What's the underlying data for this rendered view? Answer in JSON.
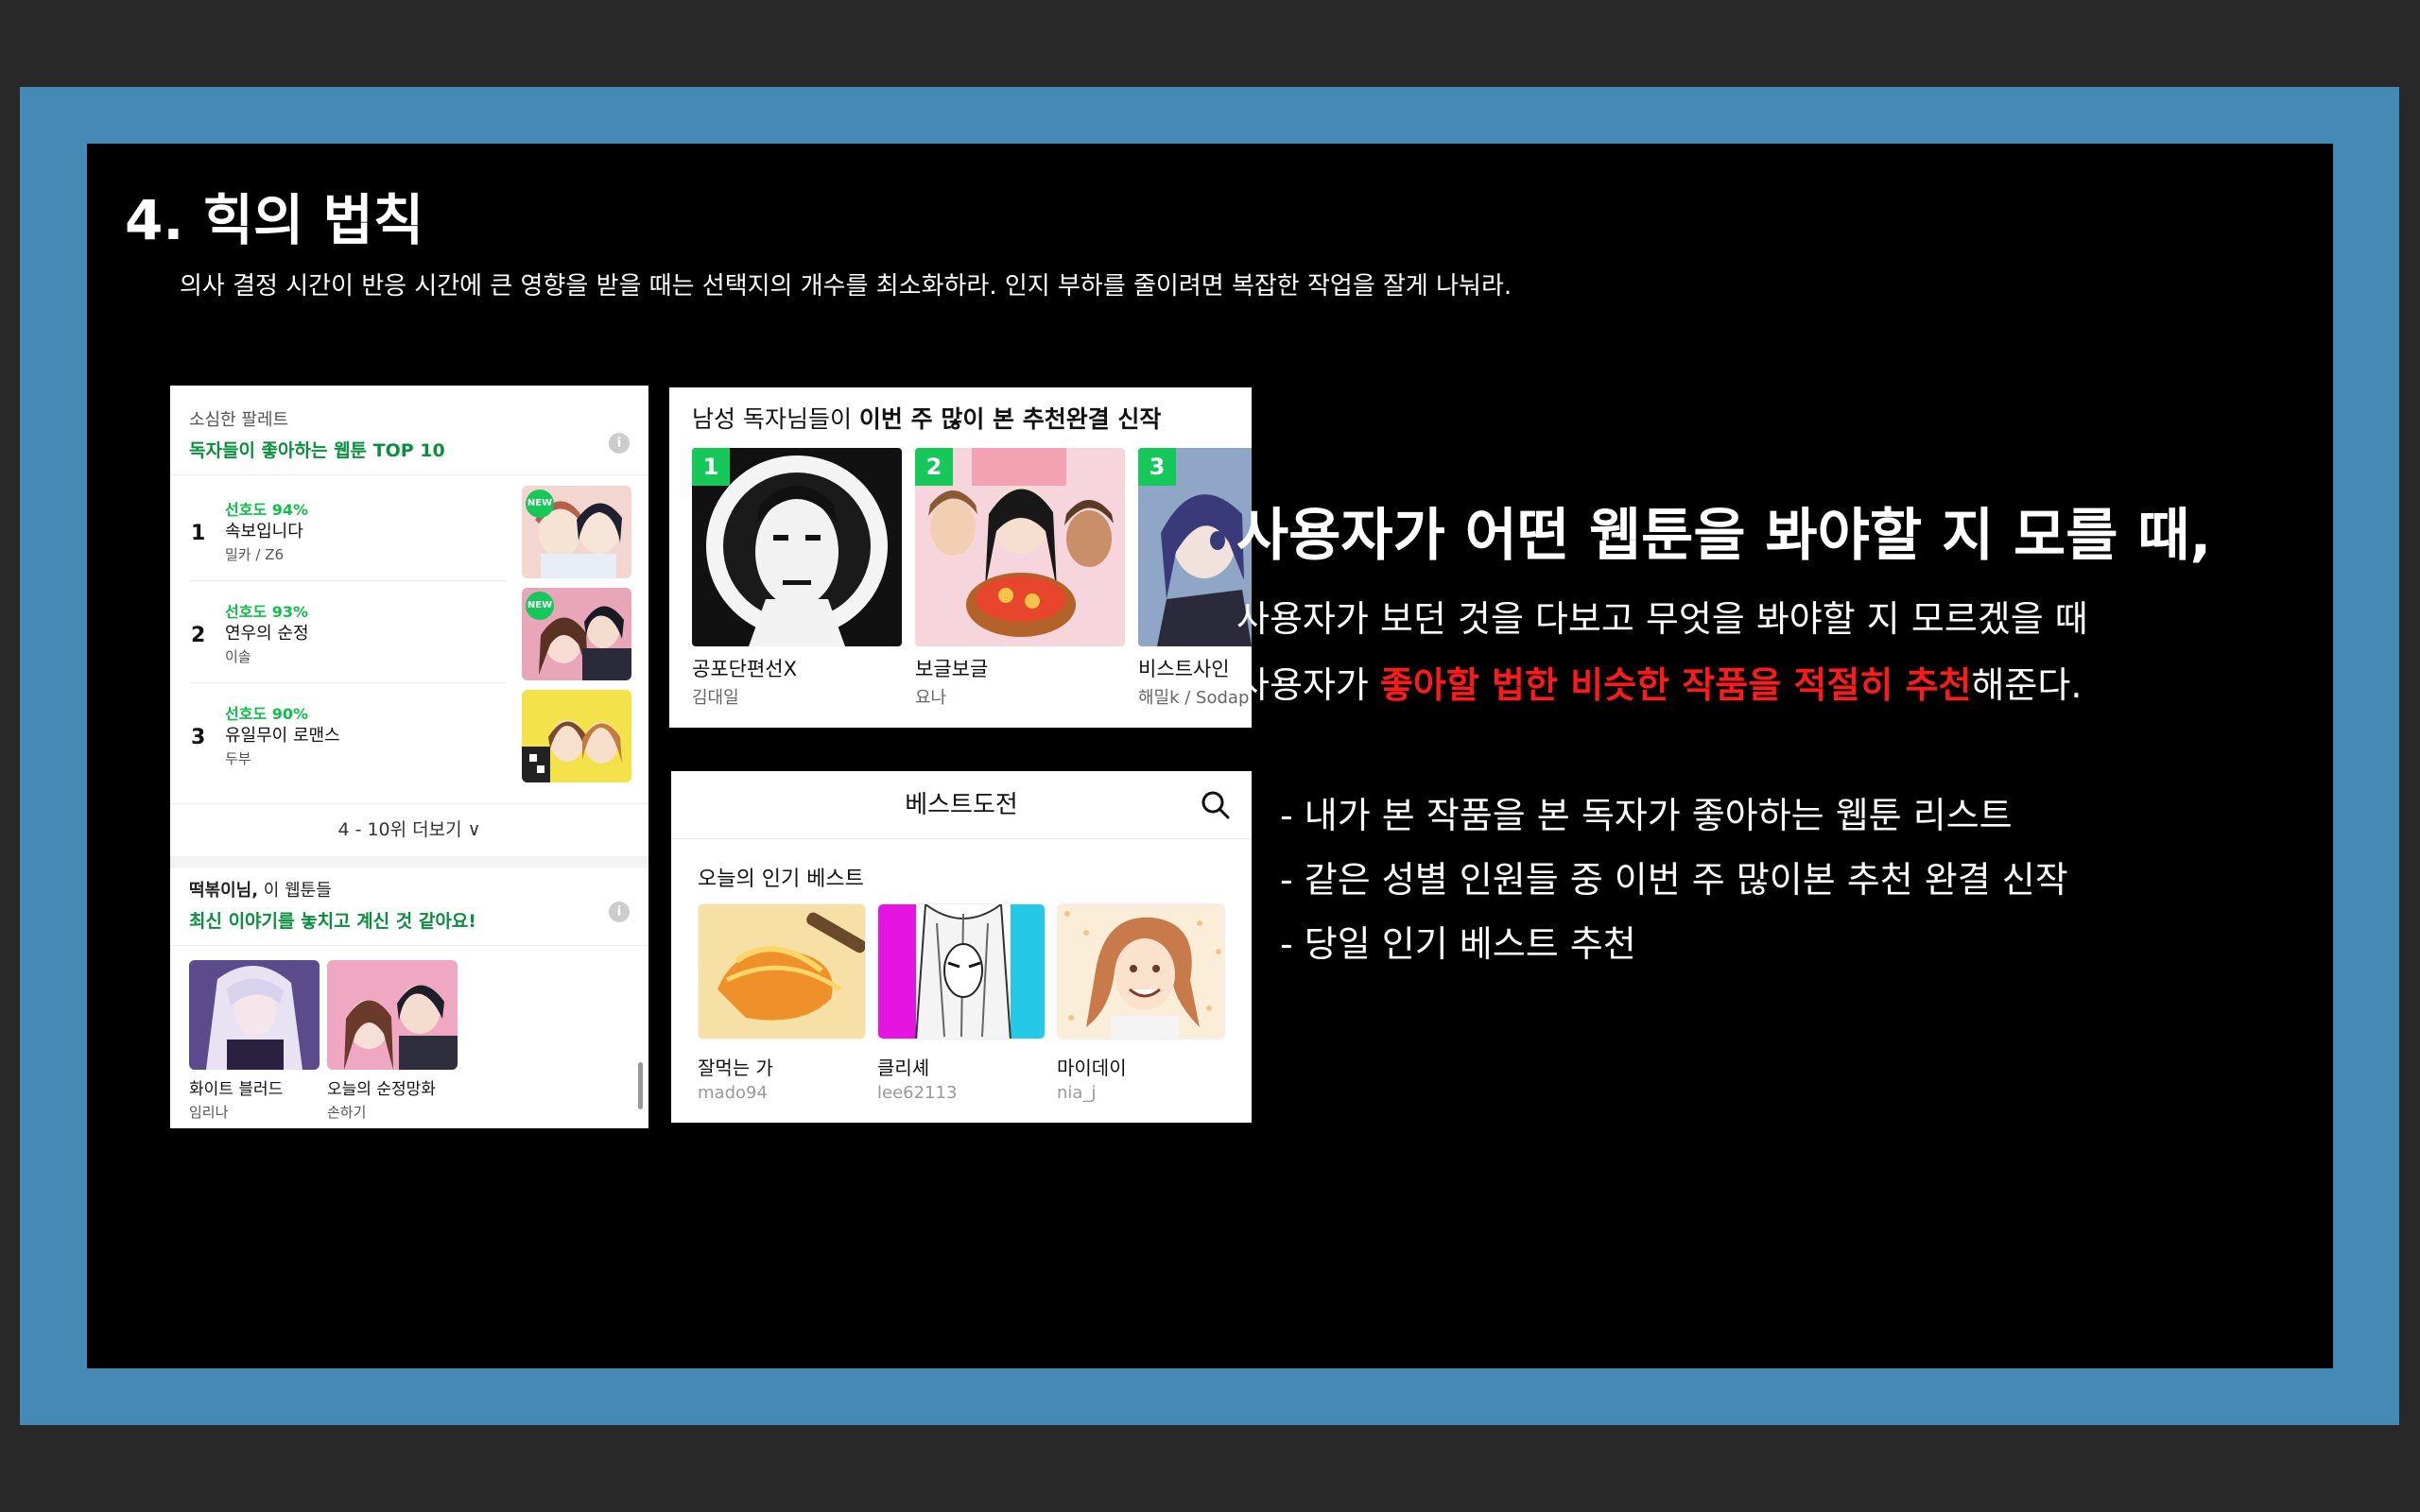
{
  "slide": {
    "title": "4. 힉의 법칙",
    "subtitle": "의사 결정 시간이 반응 시간에 큰 영향을 받을 때는 선택지의 개수를 최소화하라. 인지 부하를 줄이려면 복잡한 작업을 잘게 나눠라."
  },
  "panel1": {
    "label": "소심한 팔레트",
    "heading": "독자들이 좋아하는 웹툰 TOP 10",
    "info": "i",
    "rankings": [
      {
        "rank": "1",
        "preference": "선호도 94%",
        "title": "속보입니다",
        "author": "밀카 / Z6",
        "badge": "NEW"
      },
      {
        "rank": "2",
        "preference": "선호도 93%",
        "title": "연우의 순정",
        "author": "이솔",
        "badge": "NEW"
      },
      {
        "rank": "3",
        "preference": "선호도 90%",
        "title": "유일무이 로맨스",
        "author": "두부",
        "badge": ""
      }
    ],
    "more": "4 - 10위 더보기 ∨",
    "section2_user": "떡볶이님,",
    "section2_rest": " 이 웹툰들",
    "section2_heading": "최신 이야기를 놓치고 계신 것 같아요!",
    "cards": [
      {
        "title": "화이트 블러드",
        "author": "임리나"
      },
      {
        "title": "오늘의 순정망화",
        "author": "손하기"
      }
    ]
  },
  "panel2": {
    "heading_plain": "남성 독자님들이 ",
    "heading_bold": "이번 주 많이 본 추천완결 신작",
    "items": [
      {
        "rank": "1",
        "title": "공포단편선X",
        "author": "김대일"
      },
      {
        "rank": "2",
        "title": "보글보글",
        "author": "요나"
      },
      {
        "rank": "3",
        "title": "비스트사인",
        "author": "해밀k / Sodap"
      }
    ]
  },
  "panel3": {
    "header": "베스트도전",
    "section": "오늘의 인기 베스트",
    "items": [
      {
        "title": "잘먹는 가",
        "author": "mado94"
      },
      {
        "title": "클리셰",
        "author": "lee62113"
      },
      {
        "title": "마이데이",
        "author": "nia_j"
      }
    ]
  },
  "right": {
    "headline": "사용자가 어떤 웹툰을 봐야할 지 모를 때,",
    "line1": "사용자가 보던 것을 다보고 무엇을 봐야할 지 모르겠을 때",
    "line2_pre": "사용자가 ",
    "line2_red": "좋아할 법한 비슷한 작품을 적절히 추천",
    "line2_post": "해준다.",
    "bullets": [
      "- 내가 본 작품을 본 독자가 좋아하는 웹툰 리스트",
      "- 같은 성별 인원들 중 이번 주 많이본 추천 완결 신작",
      "- 당일 인기 베스트 추천"
    ]
  },
  "colors": {
    "frame": "#4589b5",
    "accent_green": "#16c75a",
    "highlight_red": "#ff1a1a"
  }
}
